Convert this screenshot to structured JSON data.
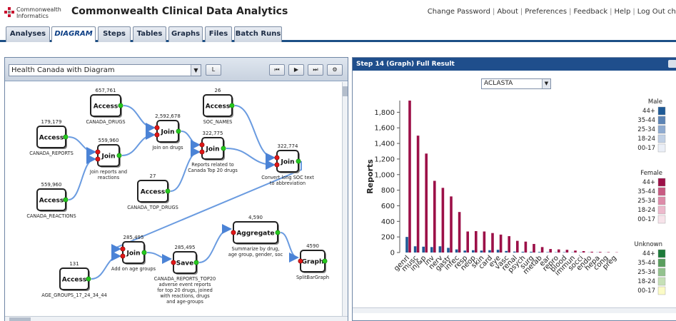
{
  "header": {
    "logo_line1": "Commonwealth",
    "logo_line2": "Informatics",
    "app_title": "Commonwealth Clinical Data Analytics",
    "links": [
      "Change Password",
      "About",
      "Preferences",
      "Feedback",
      "Help",
      "Log Out cha"
    ]
  },
  "tabs": [
    "Analyses",
    "DIAGRAM",
    "Steps",
    "Tables",
    "Graphs",
    "Files",
    "Batch Runs"
  ],
  "active_tab": "DIAGRAM",
  "left": {
    "diagram_select_value": "Health Canada with Diagram",
    "l_button": "L",
    "nodes": [
      {
        "id": "access-drugs",
        "label": "Access",
        "count": "657,761",
        "caption": [
          "CANADA_DRUGS"
        ]
      },
      {
        "id": "access-soc",
        "label": "Access",
        "count": "26",
        "caption": [
          "SOC_NAMES"
        ]
      },
      {
        "id": "access-reports",
        "label": "Access",
        "count": "179,179",
        "caption": [
          "CANADA_REPORTS"
        ]
      },
      {
        "id": "join-drugs",
        "label": "Join",
        "count": "2,592,678",
        "caption": [
          "Join on drugs"
        ]
      },
      {
        "id": "join-reports",
        "label": "Join",
        "count": "559,960",
        "caption": [
          "Join reports and",
          "reactions"
        ]
      },
      {
        "id": "join-top20",
        "label": "Join",
        "count": "322,775",
        "caption": [
          "Reports related to",
          "Canada Top 20 drugs"
        ]
      },
      {
        "id": "join-soc",
        "label": "Join",
        "count": "322,774",
        "caption": [
          "Convert long SOC text",
          "to abbreviation"
        ]
      },
      {
        "id": "access-top-drugs",
        "label": "Access",
        "count": "27",
        "caption": [
          "CANADA_TOP_DRUGS"
        ]
      },
      {
        "id": "access-reactions",
        "label": "Access",
        "count": "559,960",
        "caption": [
          "CANADA_REACTIONS"
        ]
      },
      {
        "id": "aggregate",
        "label": "Aggregate",
        "count": "4,590",
        "caption": [
          "Summarize by drug,",
          "age group, gender, soc"
        ]
      },
      {
        "id": "join-age",
        "label": "Join",
        "count": "285,495",
        "caption": [
          "Add on age groups"
        ]
      },
      {
        "id": "save",
        "label": "Save",
        "count": "285,495",
        "caption": [
          "CANADA_REPORTS_TOP20",
          "adverse event reports",
          "for top 20 drugs, joined",
          "with reactions, drugs",
          "and age-groups"
        ]
      },
      {
        "id": "graph",
        "label": "Graph",
        "count": "4590",
        "caption": [
          "SplitBarGraph"
        ]
      },
      {
        "id": "access-age",
        "label": "Access",
        "count": "131",
        "caption": [
          "AGE_GROUPS_17_24_34_44"
        ]
      }
    ]
  },
  "right": {
    "header_title": "Step 14 (Graph) Full Result",
    "drug_select_value": "ACLASTA",
    "legend": {
      "groups": [
        {
          "title": "Male",
          "items": [
            {
              "label": "44+",
              "color": "#1f5a96"
            },
            {
              "label": "35-44",
              "color": "#5d84b5"
            },
            {
              "label": "25-34",
              "color": "#8fabd0"
            },
            {
              "label": "18-24",
              "color": "#c1d0e5"
            },
            {
              "label": "00-17",
              "color": "#ebeff7"
            }
          ]
        },
        {
          "title": "Female",
          "items": [
            {
              "label": "44+",
              "color": "#9c1048"
            },
            {
              "label": "35-44",
              "color": "#c85a82"
            },
            {
              "label": "25-34",
              "color": "#dd8ba9"
            },
            {
              "label": "18-24",
              "color": "#ecb9cc"
            },
            {
              "label": "00-17",
              "color": "#f7e3ea"
            }
          ]
        },
        {
          "title": "Unknown",
          "items": [
            {
              "label": "44+",
              "color": "#1d7a3a"
            },
            {
              "label": "35-44",
              "color": "#5a9e5e"
            },
            {
              "label": "25-34",
              "color": "#93c28e"
            },
            {
              "label": "18-24",
              "color": "#c6e0b7"
            },
            {
              "label": "00-17",
              "color": "#fbfbc6"
            }
          ]
        }
      ]
    }
  },
  "chart_data": {
    "type": "bar",
    "ylabel": "Reports",
    "xlabel": "",
    "ylim": [
      0,
      1950
    ],
    "yticks": [
      "0",
      "200",
      "400",
      "600",
      "800",
      "1,000",
      "1,200",
      "1,400",
      "1,600",
      "1,800"
    ],
    "categories": [
      "genrl",
      "musc",
      "inj&p",
      "inv",
      "nerv",
      "gastr",
      "infec",
      "resp",
      "neop",
      "skin",
      "card",
      "eye",
      "vasc",
      "renal",
      "psych",
      "surg",
      "metab",
      "ear",
      "repro",
      "blood",
      "immun",
      "socci",
      "endo",
      "hepa",
      "cong",
      "preg"
    ],
    "series": [
      {
        "name": "Male",
        "color": "#1f5a96",
        "values": [
          200,
          80,
          75,
          70,
          80,
          60,
          40,
          25,
          30,
          25,
          30,
          35,
          20,
          12,
          10,
          10,
          8,
          5,
          4,
          5,
          3,
          3,
          2,
          2,
          1,
          0
        ]
      },
      {
        "name": "Female",
        "color": "#9c1048",
        "values": [
          1950,
          1500,
          1270,
          920,
          830,
          720,
          520,
          270,
          275,
          270,
          250,
          230,
          210,
          150,
          140,
          110,
          70,
          45,
          40,
          35,
          25,
          18,
          10,
          8,
          5,
          3
        ]
      }
    ]
  }
}
